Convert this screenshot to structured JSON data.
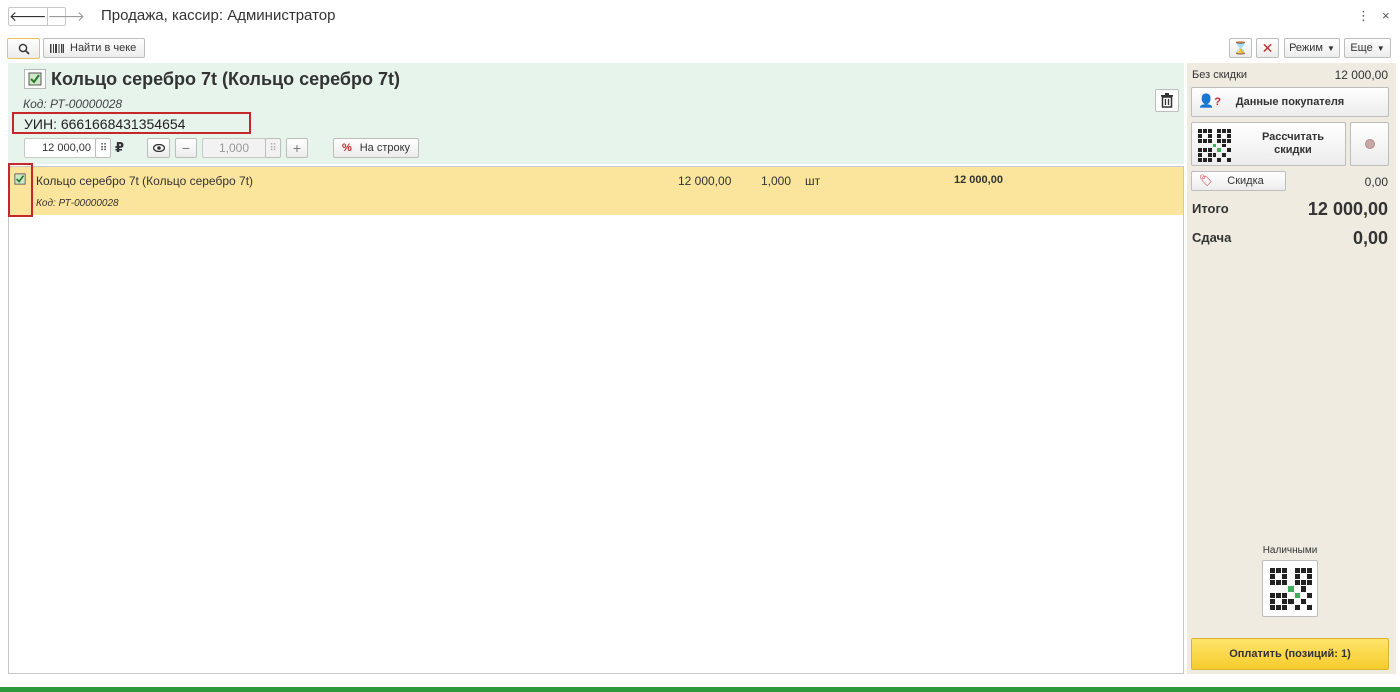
{
  "window": {
    "title": "Продажа, кассир: Администратор",
    "more_icon": "⋮",
    "close_icon": "×"
  },
  "toolbar": {
    "search_icon": "search-icon",
    "find_in_receipt": "Найти в чеке",
    "mode_label": "Режим",
    "more_label": "Еще"
  },
  "item": {
    "title": "Кольцо серебро 7t (Кольцо серебро 7t)",
    "code": "Код: РТ-00000028",
    "uin": "УИН: 6661668431354654",
    "price": "12 000,00",
    "currency": "₽",
    "quantity": "1,000",
    "discount_row_label": "На строку"
  },
  "receipt_rows": [
    {
      "name": "Кольцо серебро 7t (Кольцо серебро 7t)",
      "code": "Код: РТ-00000028",
      "price": "12 000,00",
      "qty": "1,000",
      "unit": "шт",
      "sum": "12 000,00"
    }
  ],
  "summary": {
    "without_discount_label": "Без скидки",
    "without_discount_value": "12 000,00",
    "customer_data_label": "Данные покупателя",
    "calc_discounts_label": "Рассчитать скидки",
    "discount_label": "Скидка",
    "discount_value": "0,00",
    "total_label": "Итого",
    "total_value": "12 000,00",
    "change_label": "Сдача",
    "change_value": "0,00",
    "cash_label": "Наличными",
    "pay_label": "Оплатить (позиций: 1)"
  },
  "colors": {
    "accent_green": "#2a9a3c",
    "highlight_row": "#fbe59c",
    "item_panel": "#e6f4ec",
    "right_panel": "#f0ebe0",
    "pay_button": "#f6cc2c",
    "annotation_red": "#c4282a"
  }
}
